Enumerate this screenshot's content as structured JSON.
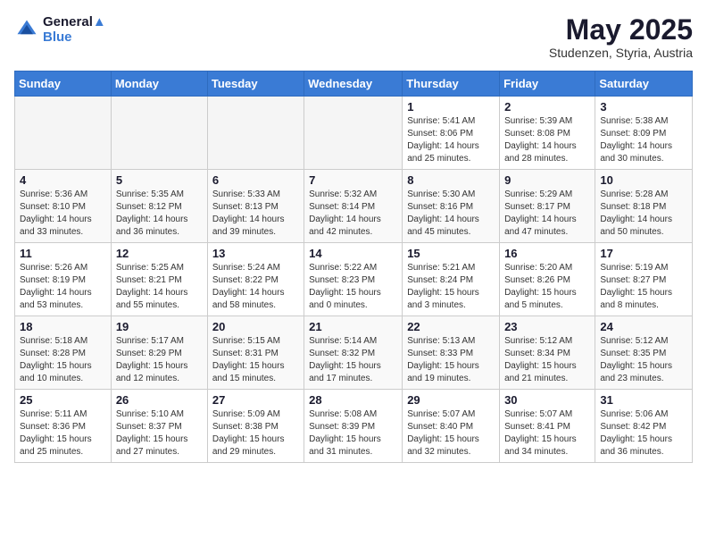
{
  "header": {
    "logo_line1": "General",
    "logo_line2": "Blue",
    "month": "May 2025",
    "location": "Studenzen, Styria, Austria"
  },
  "weekdays": [
    "Sunday",
    "Monday",
    "Tuesday",
    "Wednesday",
    "Thursday",
    "Friday",
    "Saturday"
  ],
  "weeks": [
    [
      {
        "day": "",
        "info": ""
      },
      {
        "day": "",
        "info": ""
      },
      {
        "day": "",
        "info": ""
      },
      {
        "day": "",
        "info": ""
      },
      {
        "day": "1",
        "info": "Sunrise: 5:41 AM\nSunset: 8:06 PM\nDaylight: 14 hours\nand 25 minutes."
      },
      {
        "day": "2",
        "info": "Sunrise: 5:39 AM\nSunset: 8:08 PM\nDaylight: 14 hours\nand 28 minutes."
      },
      {
        "day": "3",
        "info": "Sunrise: 5:38 AM\nSunset: 8:09 PM\nDaylight: 14 hours\nand 30 minutes."
      }
    ],
    [
      {
        "day": "4",
        "info": "Sunrise: 5:36 AM\nSunset: 8:10 PM\nDaylight: 14 hours\nand 33 minutes."
      },
      {
        "day": "5",
        "info": "Sunrise: 5:35 AM\nSunset: 8:12 PM\nDaylight: 14 hours\nand 36 minutes."
      },
      {
        "day": "6",
        "info": "Sunrise: 5:33 AM\nSunset: 8:13 PM\nDaylight: 14 hours\nand 39 minutes."
      },
      {
        "day": "7",
        "info": "Sunrise: 5:32 AM\nSunset: 8:14 PM\nDaylight: 14 hours\nand 42 minutes."
      },
      {
        "day": "8",
        "info": "Sunrise: 5:30 AM\nSunset: 8:16 PM\nDaylight: 14 hours\nand 45 minutes."
      },
      {
        "day": "9",
        "info": "Sunrise: 5:29 AM\nSunset: 8:17 PM\nDaylight: 14 hours\nand 47 minutes."
      },
      {
        "day": "10",
        "info": "Sunrise: 5:28 AM\nSunset: 8:18 PM\nDaylight: 14 hours\nand 50 minutes."
      }
    ],
    [
      {
        "day": "11",
        "info": "Sunrise: 5:26 AM\nSunset: 8:19 PM\nDaylight: 14 hours\nand 53 minutes."
      },
      {
        "day": "12",
        "info": "Sunrise: 5:25 AM\nSunset: 8:21 PM\nDaylight: 14 hours\nand 55 minutes."
      },
      {
        "day": "13",
        "info": "Sunrise: 5:24 AM\nSunset: 8:22 PM\nDaylight: 14 hours\nand 58 minutes."
      },
      {
        "day": "14",
        "info": "Sunrise: 5:22 AM\nSunset: 8:23 PM\nDaylight: 15 hours\nand 0 minutes."
      },
      {
        "day": "15",
        "info": "Sunrise: 5:21 AM\nSunset: 8:24 PM\nDaylight: 15 hours\nand 3 minutes."
      },
      {
        "day": "16",
        "info": "Sunrise: 5:20 AM\nSunset: 8:26 PM\nDaylight: 15 hours\nand 5 minutes."
      },
      {
        "day": "17",
        "info": "Sunrise: 5:19 AM\nSunset: 8:27 PM\nDaylight: 15 hours\nand 8 minutes."
      }
    ],
    [
      {
        "day": "18",
        "info": "Sunrise: 5:18 AM\nSunset: 8:28 PM\nDaylight: 15 hours\nand 10 minutes."
      },
      {
        "day": "19",
        "info": "Sunrise: 5:17 AM\nSunset: 8:29 PM\nDaylight: 15 hours\nand 12 minutes."
      },
      {
        "day": "20",
        "info": "Sunrise: 5:15 AM\nSunset: 8:31 PM\nDaylight: 15 hours\nand 15 minutes."
      },
      {
        "day": "21",
        "info": "Sunrise: 5:14 AM\nSunset: 8:32 PM\nDaylight: 15 hours\nand 17 minutes."
      },
      {
        "day": "22",
        "info": "Sunrise: 5:13 AM\nSunset: 8:33 PM\nDaylight: 15 hours\nand 19 minutes."
      },
      {
        "day": "23",
        "info": "Sunrise: 5:12 AM\nSunset: 8:34 PM\nDaylight: 15 hours\nand 21 minutes."
      },
      {
        "day": "24",
        "info": "Sunrise: 5:12 AM\nSunset: 8:35 PM\nDaylight: 15 hours\nand 23 minutes."
      }
    ],
    [
      {
        "day": "25",
        "info": "Sunrise: 5:11 AM\nSunset: 8:36 PM\nDaylight: 15 hours\nand 25 minutes."
      },
      {
        "day": "26",
        "info": "Sunrise: 5:10 AM\nSunset: 8:37 PM\nDaylight: 15 hours\nand 27 minutes."
      },
      {
        "day": "27",
        "info": "Sunrise: 5:09 AM\nSunset: 8:38 PM\nDaylight: 15 hours\nand 29 minutes."
      },
      {
        "day": "28",
        "info": "Sunrise: 5:08 AM\nSunset: 8:39 PM\nDaylight: 15 hours\nand 31 minutes."
      },
      {
        "day": "29",
        "info": "Sunrise: 5:07 AM\nSunset: 8:40 PM\nDaylight: 15 hours\nand 32 minutes."
      },
      {
        "day": "30",
        "info": "Sunrise: 5:07 AM\nSunset: 8:41 PM\nDaylight: 15 hours\nand 34 minutes."
      },
      {
        "day": "31",
        "info": "Sunrise: 5:06 AM\nSunset: 8:42 PM\nDaylight: 15 hours\nand 36 minutes."
      }
    ]
  ]
}
